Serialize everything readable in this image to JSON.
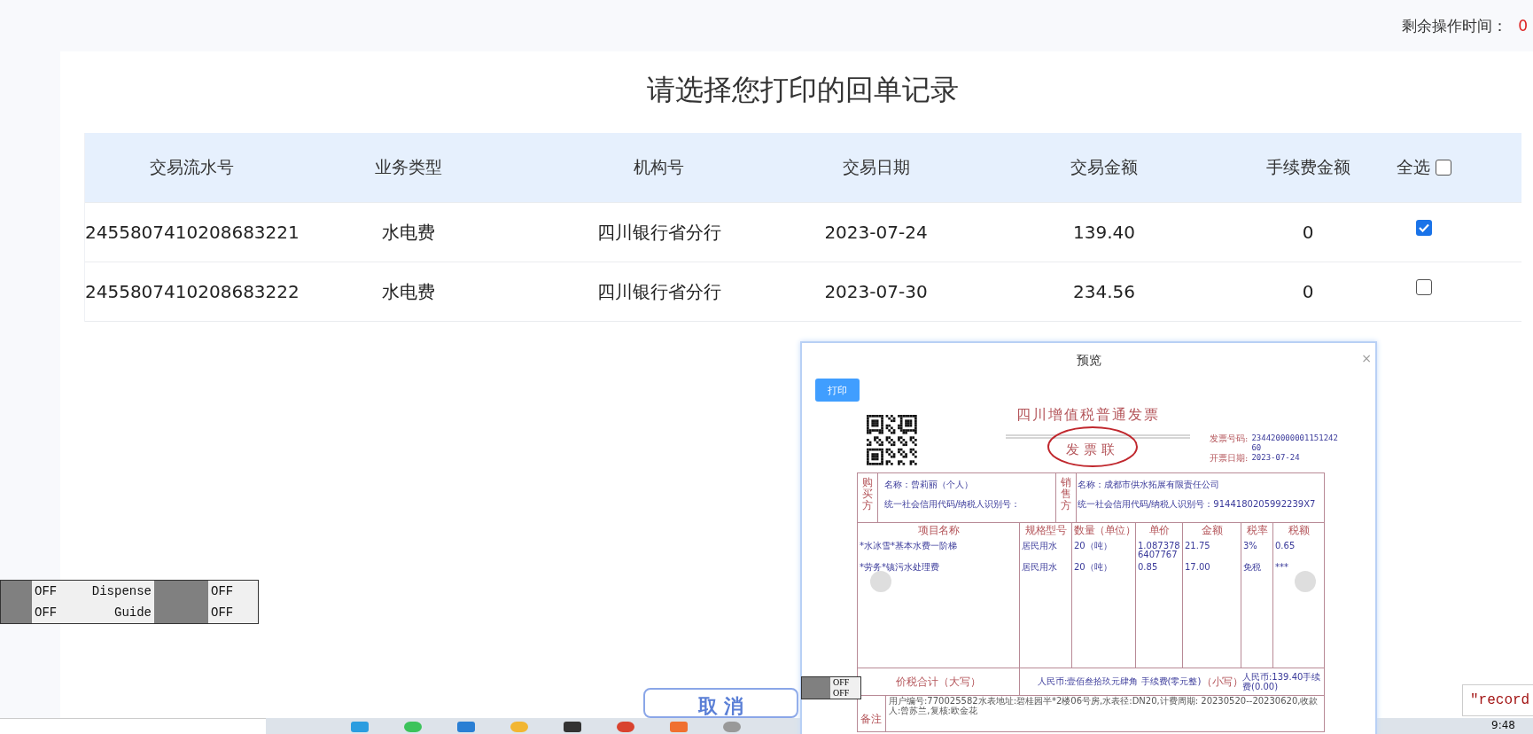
{
  "timer": {
    "label": "剩余操作时间：",
    "value": "0"
  },
  "title": "请选择您打印的回单记录",
  "table": {
    "columns": [
      "交易流水号",
      "业务类型",
      "机构号",
      "交易日期",
      "交易金额",
      "手续费金额"
    ],
    "select_all": {
      "label": "全选",
      "checked": false
    },
    "rows": [
      {
        "cells": [
          "2455807410208683221",
          "水电费",
          "四川银行省分行",
          "2023-07-24",
          "139.40",
          "0"
        ],
        "checked": true
      },
      {
        "cells": [
          "2455807410208683222",
          "水电费",
          "四川银行省分行",
          "2023-07-30",
          "234.56",
          "0"
        ],
        "checked": false
      }
    ]
  },
  "status_panel": {
    "rows": [
      {
        "left": "OFF",
        "label": "Dispense",
        "right": "OFF"
      },
      {
        "left": "OFF",
        "label": "Guide",
        "right": "OFF"
      }
    ]
  },
  "mini_status": [
    "OFF",
    "OFF"
  ],
  "cancel_button": "取 消",
  "preview": {
    "title": "预览",
    "close": "×",
    "print_button": "打印",
    "invoice": {
      "title": "四川增值税普通发票",
      "copy_label": "发 票 联",
      "number_label": "发票号码:",
      "number_lines": [
        "234420000001151242",
        "60"
      ],
      "date_label": "开票日期:",
      "date": "2023-07-24",
      "buyer": {
        "label": "购买方",
        "name": "名称：曾莉丽（个人）",
        "tax_id": "统一社会信用代码/纳税人识别号："
      },
      "seller": {
        "label": "销售方",
        "name": "名称：成都市供水拓展有限责任公司",
        "tax_id": "统一社会信用代码/纳税人识别号：9144180205992239X7"
      },
      "columns": [
        "项目名称",
        "规格型号",
        "数量（单位）",
        "单价",
        "金额",
        "税率",
        "税额"
      ],
      "items": [
        [
          "*水冰雪*基本水费一阶梯",
          "居民用水",
          "20（吨）",
          "1.0873786407767",
          "21.75",
          "3%",
          "0.65"
        ],
        [
          "*劳务*镇污水处理费",
          "居民用水",
          "20（吨）",
          "0.85",
          "17.00",
          "免税",
          "***"
        ]
      ],
      "total_label": "价税合计（大写）",
      "total_value": "人民币:壹佰叁拾玖元肆角 手续费(零元整)",
      "small_label": "（小写）",
      "small_value": "人民币:139.40手续费(0.00)",
      "remark_label": "备注",
      "remark": "用户编号:770025582水表地址:碧桂园半*2楼06号房,水表径:DN20,计费周期: 20230520--20230620,收款人:曾苏兰,复核:欧金花"
    }
  },
  "tooltip": "\"record",
  "taskbar": {
    "clock": "9:48"
  }
}
